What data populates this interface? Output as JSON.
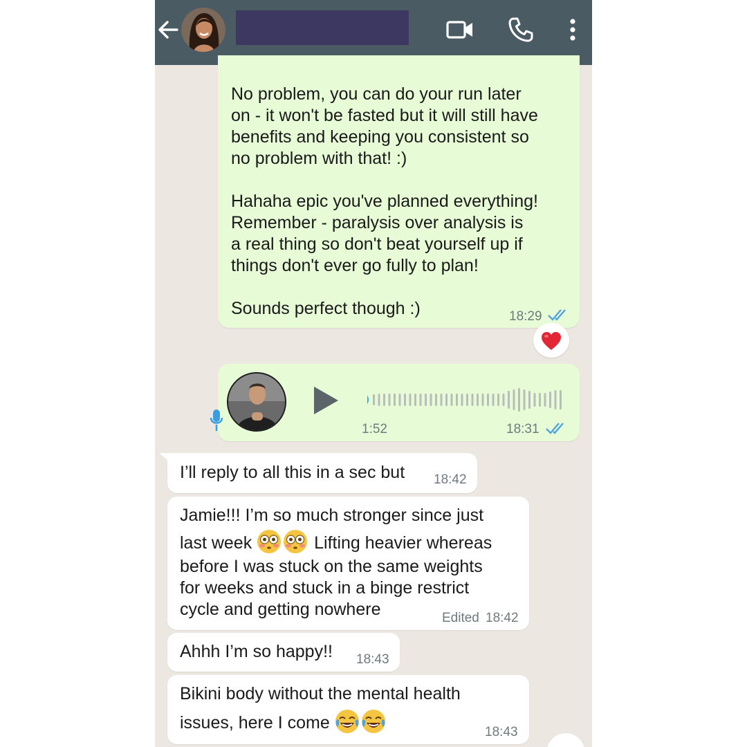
{
  "header": {
    "contact_name": "",
    "back_icon": "arrow-left-icon",
    "video_icon": "video-call-icon",
    "phone_icon": "phone-call-icon",
    "menu_icon": "more-vert-icon",
    "background": "#4b5b63"
  },
  "messages": [
    {
      "direction": "outgoing",
      "paragraphs": [
        "No problem, you can do your run later\non - it won't be fasted but it will still have\nbenefits and keeping you consistent so\nno problem with that! :)",
        "Hahaha epic you've planned everything!\nRemember - paralysis over analysis is\na real thing so don't beat yourself up if\nthings don't ever go fully to plan!",
        "Sounds perfect though :)"
      ],
      "time": "18:29",
      "status": "read",
      "reaction": "red-heart"
    },
    {
      "direction": "outgoing",
      "type": "voice",
      "duration": "1:52",
      "time": "18:31",
      "status": "read"
    },
    {
      "direction": "incoming",
      "text": "I’ll reply to all this in a sec but",
      "time": "18:42"
    },
    {
      "direction": "incoming",
      "line1": "Jamie!!! I’m so much stronger since just",
      "line2_before": "last week",
      "line2_after": "Lifting heavier whereas",
      "rest": "before I was stuck on the same weights\nfor weeks and stuck in a binge restrict\ncycle and getting nowhere",
      "edited_label": "Edited",
      "time": "18:42",
      "emoji": "flushed-face"
    },
    {
      "direction": "incoming",
      "text": "Ahhh I’m so happy!!",
      "time": "18:43"
    },
    {
      "direction": "incoming",
      "line1": "Bikini body without the mental health",
      "line2": "issues, here I come",
      "time": "18:43",
      "emoji": "tears-of-joy"
    }
  ],
  "colors": {
    "chat_background": "#ece7e1",
    "outgoing_bubble": "#e7fbd6",
    "incoming_bubble": "#ffffff",
    "read_ticks": "#4fa3e0"
  }
}
